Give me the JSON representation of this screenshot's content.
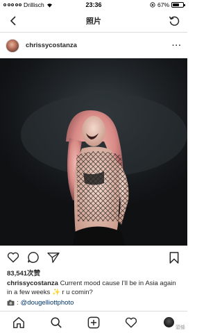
{
  "status_bar": {
    "carrier": "Drillisch",
    "time": "23:36",
    "battery": "67%",
    "battery_level": 0.67
  },
  "nav": {
    "title": "照片"
  },
  "post": {
    "username": "chrissycostanza",
    "likes": "83,541次赞",
    "caption_user": "chrissycostanza",
    "caption_text": "Current mood cause I'll be in Asia again in a few weeks ✨ r u comin?",
    "credit": "@dougelliottphoto"
  },
  "watermark": "頭條"
}
